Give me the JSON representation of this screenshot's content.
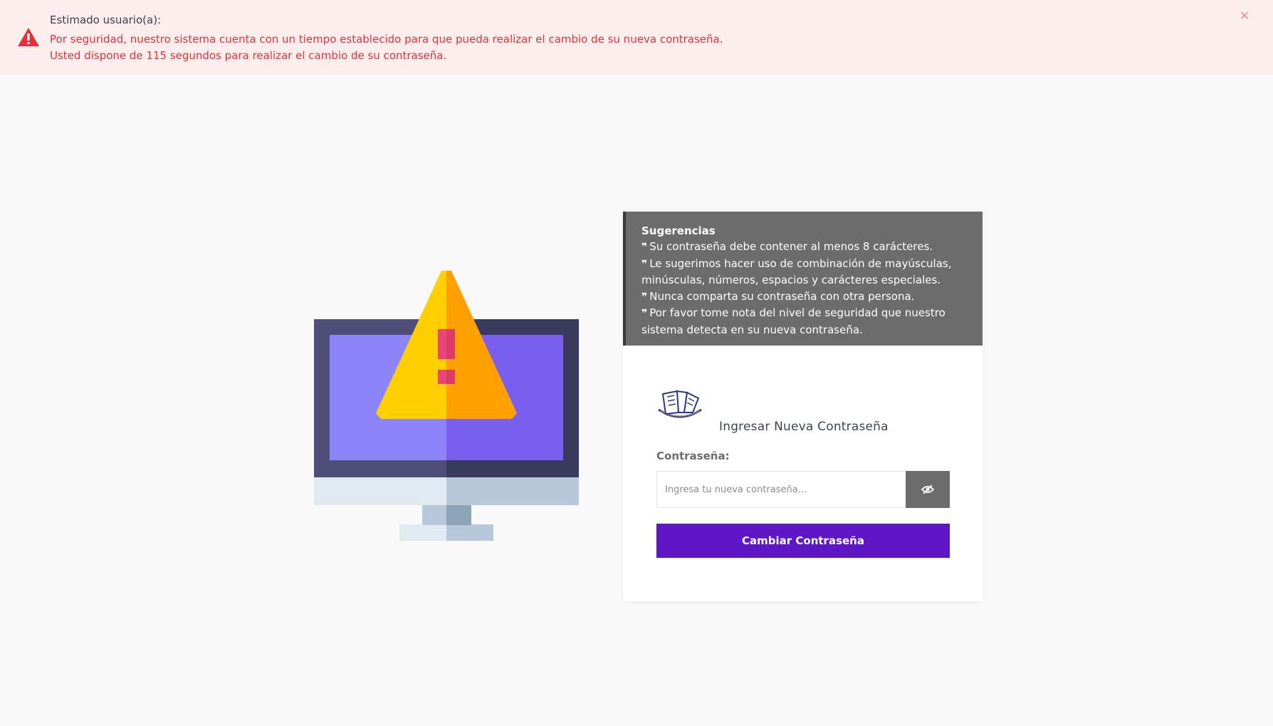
{
  "alert": {
    "title": "Estimado usuario(a):",
    "line1": "Por seguridad, nuestro sistema cuenta con un tiempo establecido para que pueda realizar el cambio de su nueva contraseña.",
    "line2": "Usted dispone de 115 segundos para realizar el cambio de su contraseña.",
    "close_label": "×",
    "icon": "warning-triangle-icon",
    "color": "#e0303e",
    "background": "#fdeeee"
  },
  "illustration": {
    "icon": "monitor-warning-illustration"
  },
  "tips": {
    "title": "Sugerencias",
    "items": [
      "Su contraseña debe contener al menos 8 carácteres.",
      "Le sugerimos hacer uso de combinación de mayúsculas, minúsculas, números, espacios y carácteres especiales.",
      "Nunca comparta su contraseña con otra persona.",
      "Por favor tome nota del nivel de seguridad que nuestro sistema detecta en su nueva contraseña."
    ],
    "quote_mark": "❞"
  },
  "form": {
    "logo_icon": "institution-logo-icon",
    "title": "Ingresar Nueva Contraseña",
    "password_label": "Contraseña:",
    "password_placeholder": "Ingresa tu nueva contraseña...",
    "password_value": "",
    "toggle_icon": "eye-slash-icon",
    "submit_label": "Cambiar Contraseña",
    "accent": "#5f17c6"
  }
}
